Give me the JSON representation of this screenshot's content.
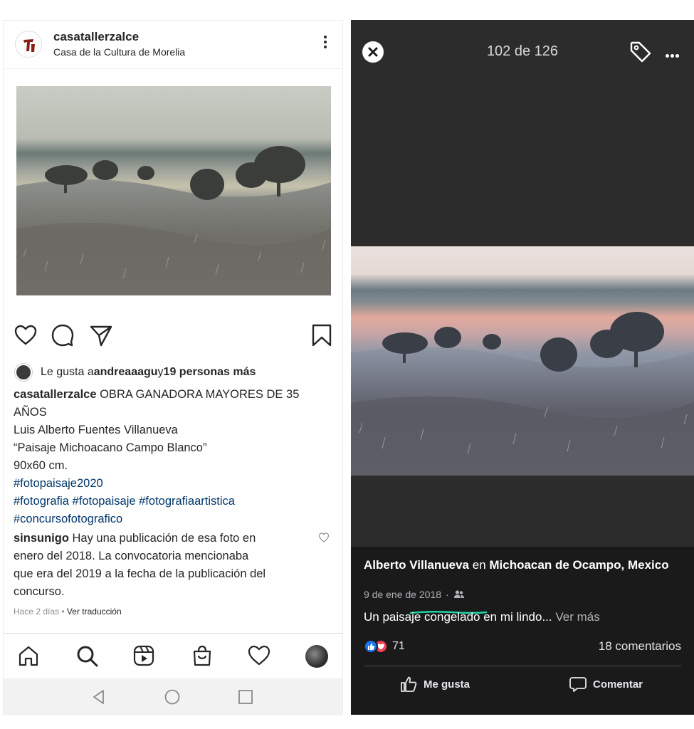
{
  "instagram": {
    "username": "casatallerzalce",
    "location": "Casa de la Cultura de Morelia",
    "likes": {
      "prefix": "Le gusta a ",
      "user": "andreaaagu",
      "middle": " y ",
      "others": "19 personas más"
    },
    "caption": {
      "author": "casatallerzalce",
      "line1": " OBRA GANADORA MAYORES DE  35",
      "line2": "AÑOS",
      "line3": "Luis Alberto Fuentes Villanueva",
      "line4": " “Paisaje Michoacano Campo Blanco”",
      "line5": "90x60 cm.",
      "hashtags_line1": "#fotopaisaje2020",
      "hashtags_line2": "#fotografia #fotopaisaje #fotografiaartistica",
      "hashtags_line3": "#concursofotografico"
    },
    "comment": {
      "author": "sinsunigo",
      "line1": " Hay una publicación de esa foto en",
      "line2": "enero del 2018. La convocatoria mencionaba",
      "line3": "que era del 2019 a la fecha de la publicación del",
      "line4": "concurso."
    },
    "comment_meta": {
      "age": "Hace 2 días",
      "separator": " • ",
      "translate": "Ver traducción"
    }
  },
  "facebook": {
    "counter": "102 de 126",
    "author": "Alberto Villanueva",
    "connector": " en ",
    "place": "Michoacan de Ocampo, Mexico",
    "date": "9 de ene de 2018",
    "date_separator": "·",
    "caption": "Un paisaje congelado en mi lindo...",
    "see_more": " Ver más",
    "reaction_count": "71",
    "comments_count": "18 comentarios",
    "like_label": "Me gusta",
    "comment_label": "Comentar",
    "highlight_color": "#1ed4a8"
  }
}
